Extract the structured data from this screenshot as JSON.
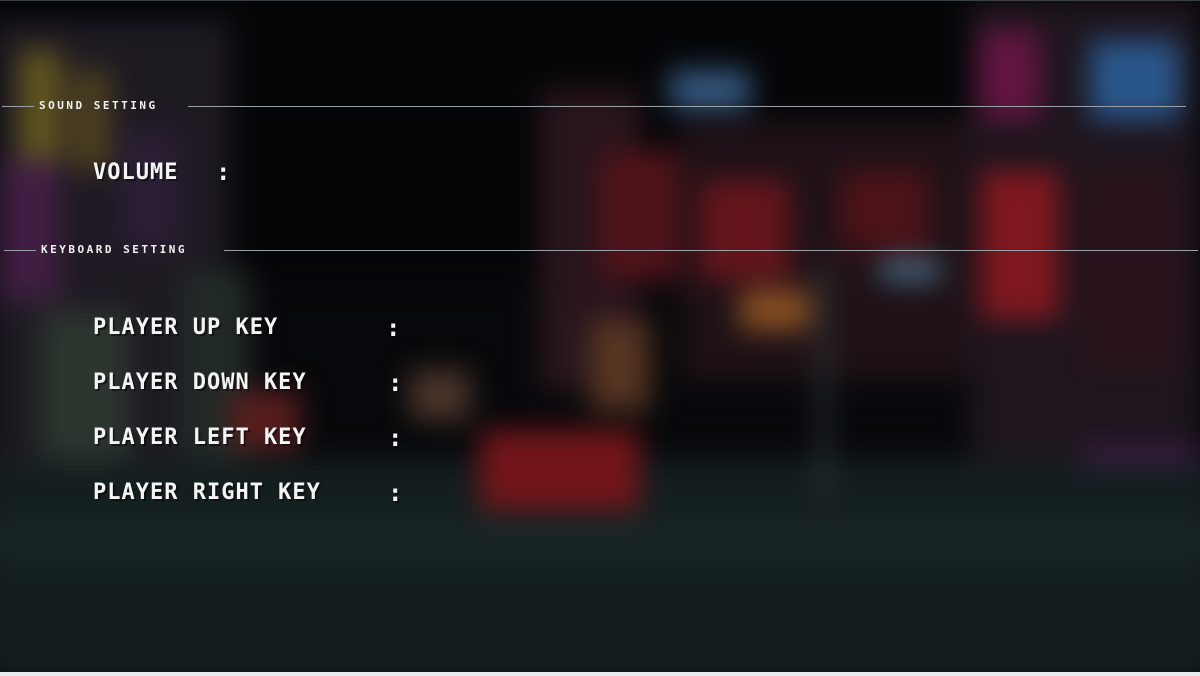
{
  "sound_section": {
    "title": "SOUND SETTING"
  },
  "volume": {
    "label": "VOLUME",
    "colon": ":"
  },
  "keyboard_section": {
    "title": "KEYBOARD SETTING"
  },
  "keys": [
    {
      "label": "PLAYER UP KEY",
      "colon": ":"
    },
    {
      "label": "PLAYER DOWN KEY",
      "colon": ":"
    },
    {
      "label": "PLAYER LEFT KEY",
      "colon": ":"
    },
    {
      "label": "PLAYER RIGHT KEY",
      "colon": ":"
    }
  ],
  "colors": {
    "text": "#f4f4f4",
    "rule": "#9aa0a8",
    "neon_red": "#b3202a",
    "neon_blue": "#3b7bbd",
    "neon_purple": "#7a2a8a"
  }
}
